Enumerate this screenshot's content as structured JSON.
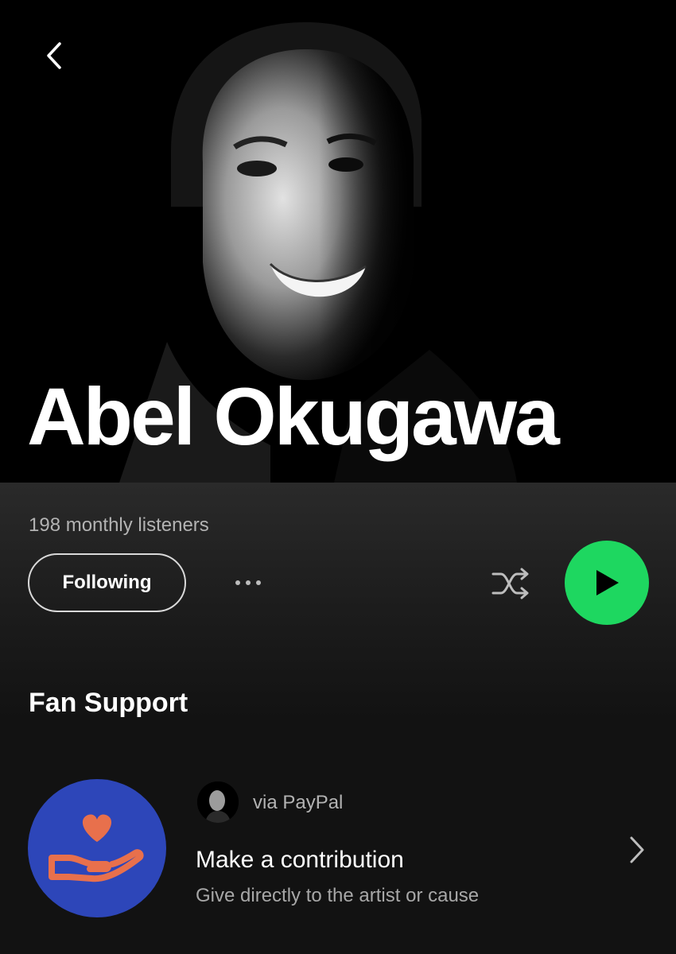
{
  "artist": {
    "name": "Abel Okugawa",
    "monthly_listeners": "198 monthly listeners"
  },
  "actions": {
    "follow_label": "Following",
    "more_icon": "more-horizontal-icon",
    "shuffle_icon": "shuffle-icon",
    "play_icon": "play-icon"
  },
  "fan_support": {
    "section_title": "Fan Support",
    "via_label": "via PayPal",
    "title": "Make a contribution",
    "subtitle": "Give directly to the artist or cause"
  },
  "colors": {
    "play_button": "#1ed760",
    "support_logo_bg": "#2d46b9",
    "support_logo_accent": "#e8704c"
  }
}
